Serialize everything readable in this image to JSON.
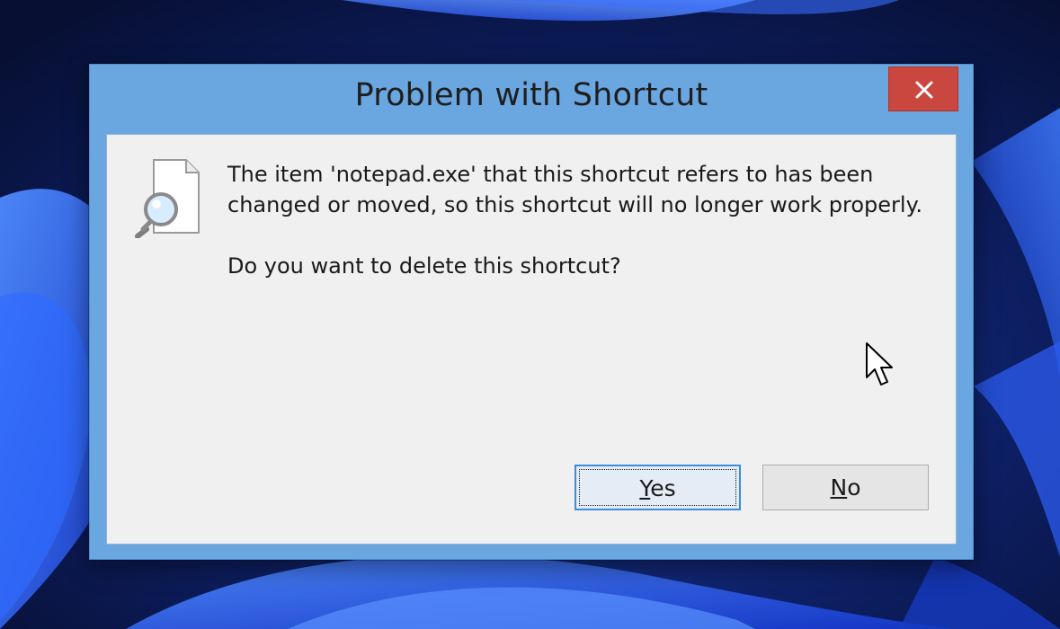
{
  "dialog": {
    "title": "Problem with Shortcut",
    "close_glyph": "✕",
    "message_line1": "The item 'notepad.exe' that this shortcut refers to has been",
    "message_line2": "changed or moved, so this shortcut will no longer work properly.",
    "question": "Do you want to delete this shortcut?",
    "icon": "document-magnifier-icon",
    "buttons": {
      "yes": {
        "mnemonic": "Y",
        "rest": "es",
        "focused": true
      },
      "no": {
        "mnemonic": "N",
        "rest": "o",
        "focused": false
      }
    }
  },
  "colors": {
    "frame": "#6aa6e0",
    "close_button": "#c9473f",
    "client_background": "#f0f0f0",
    "focus_border": "#3c8ce0",
    "wallpaper_dark": "#0a1640",
    "wallpaper_bloom": "#2a5bff"
  }
}
